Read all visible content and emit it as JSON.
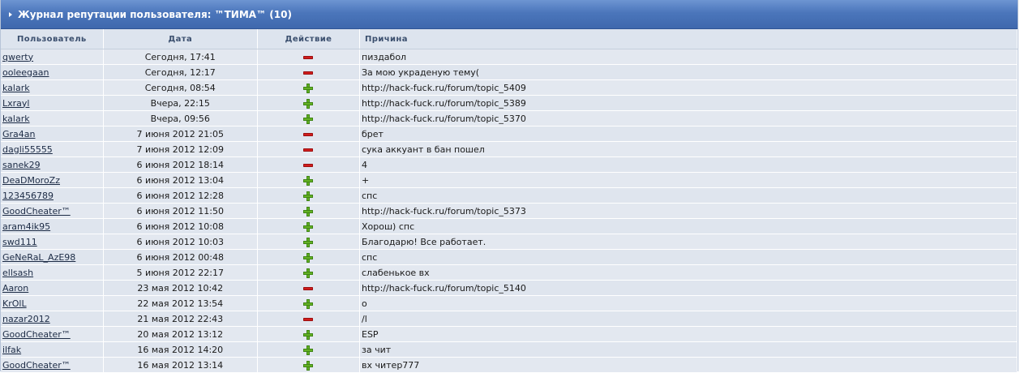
{
  "title": "Журнал репутации пользователя: ™ТИМА™ (10)",
  "columns": [
    "Пользователь",
    "Дата",
    "Действие",
    "Причина"
  ],
  "rows": [
    {
      "user": "qwerty",
      "date": "Сегодня, 17:41",
      "action": "minus",
      "reason": "пиздабол"
    },
    {
      "user": "ooleegaan",
      "date": "Сегодня, 12:17",
      "action": "minus",
      "reason": "За мою украденую тему("
    },
    {
      "user": "kalark",
      "date": "Сегодня, 08:54",
      "action": "plus",
      "reason": "http://hack-fuck.ru/forum/topic_5409"
    },
    {
      "user": "Lxrayl",
      "date": "Вчера, 22:15",
      "action": "plus",
      "reason": "http://hack-fuck.ru/forum/topic_5389"
    },
    {
      "user": "kalark",
      "date": "Вчера, 09:56",
      "action": "plus",
      "reason": "http://hack-fuck.ru/forum/topic_5370"
    },
    {
      "user": "Gra4an",
      "date": "7 июня 2012 21:05",
      "action": "minus",
      "reason": "брет"
    },
    {
      "user": "dagli55555",
      "date": "7 июня 2012 12:09",
      "action": "minus",
      "reason": "сука аккуант в бан пошел"
    },
    {
      "user": "sanek29",
      "date": "6 июня 2012 18:14",
      "action": "minus",
      "reason": "4"
    },
    {
      "user": "DeaDMoroZz",
      "date": "6 июня 2012 13:04",
      "action": "plus",
      "reason": "+"
    },
    {
      "user": "123456789",
      "date": "6 июня 2012 12:28",
      "action": "plus",
      "reason": "спс"
    },
    {
      "user": "GoodCheater™",
      "date": "6 июня 2012 11:50",
      "action": "plus",
      "reason": "http://hack-fuck.ru/forum/topic_5373"
    },
    {
      "user": "aram4ik95",
      "date": "6 июня 2012 10:08",
      "action": "plus",
      "reason": "Хорош) спс"
    },
    {
      "user": "swd111",
      "date": "6 июня 2012 10:03",
      "action": "plus",
      "reason": "Благодарю! Все работает."
    },
    {
      "user": "GeNeRaL_AzE98",
      "date": "6 июня 2012 00:48",
      "action": "plus",
      "reason": "спс"
    },
    {
      "user": "ellsash",
      "date": "5 июня 2012 22:17",
      "action": "plus",
      "reason": "слабенькое вх"
    },
    {
      "user": "Aaron",
      "date": "23 мая 2012 10:42",
      "action": "minus",
      "reason": "http://hack-fuck.ru/forum/topic_5140"
    },
    {
      "user": "KrOlL",
      "date": "22 мая 2012 13:54",
      "action": "plus",
      "reason": "о"
    },
    {
      "user": "nazar2012",
      "date": "21 мая 2012 22:43",
      "action": "minus",
      "reason": "/l"
    },
    {
      "user": "GoodCheater™",
      "date": "20 мая 2012 13:12",
      "action": "plus",
      "reason": "ESP"
    },
    {
      "user": "ilfak",
      "date": "16 мая 2012 14:20",
      "action": "plus",
      "reason": "за чит"
    },
    {
      "user": "GoodCheater™",
      "date": "16 мая 2012 13:14",
      "action": "plus",
      "reason": "вх читер777"
    }
  ]
}
